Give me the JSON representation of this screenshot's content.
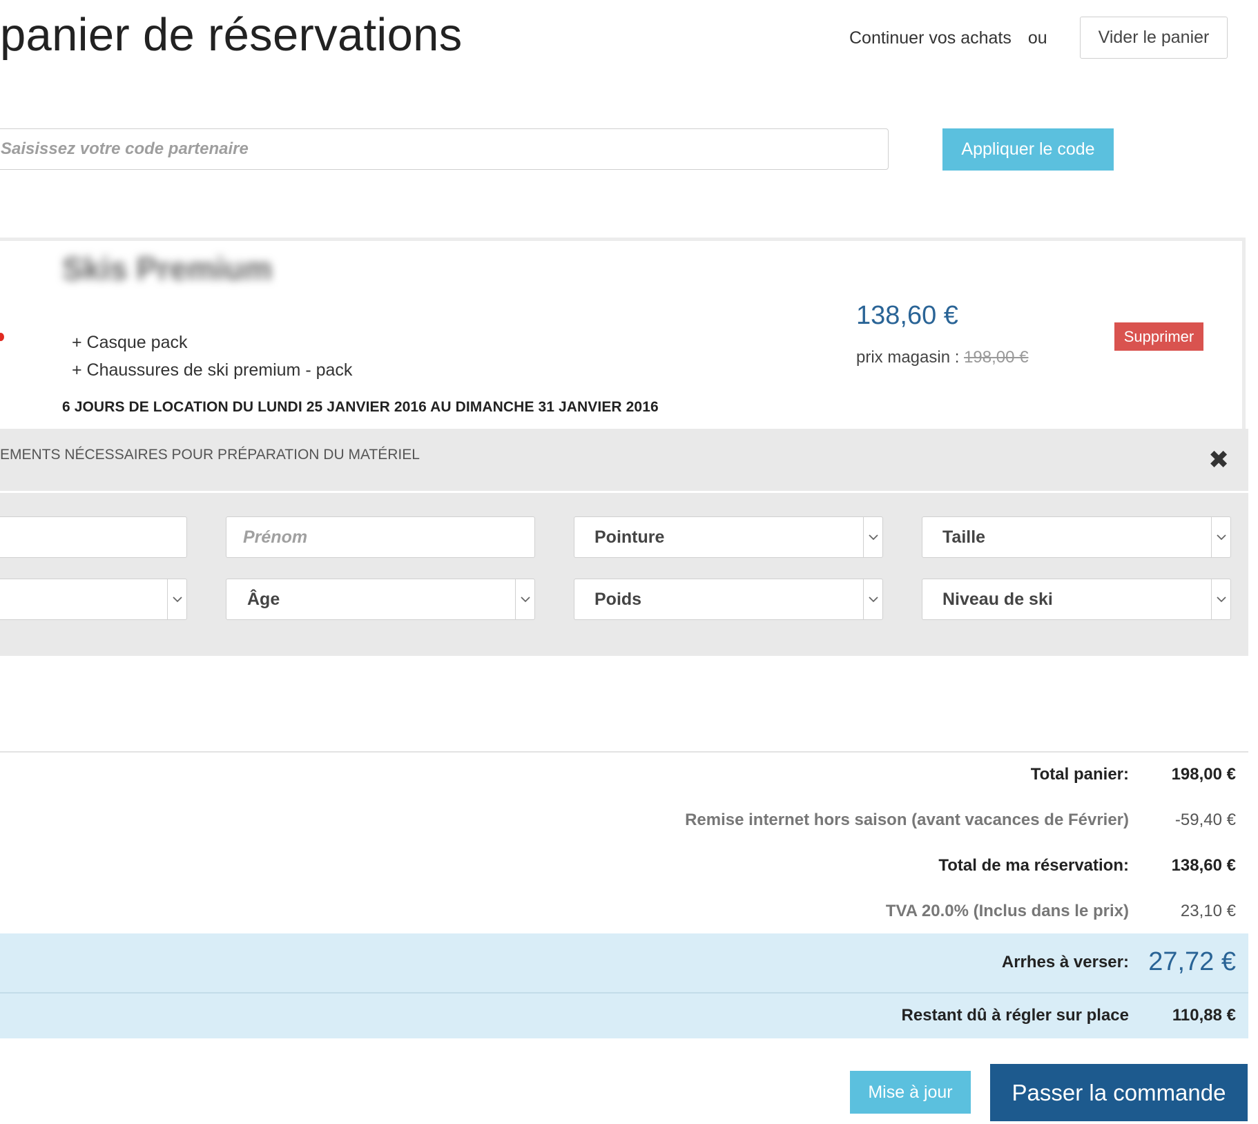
{
  "header": {
    "title": "panier de réservations",
    "continue_link": "Continuer vos achats",
    "or_text": "ou",
    "empty_cart_label": "Vider le panier"
  },
  "partner_code": {
    "placeholder": "Saisissez votre code partenaire",
    "apply_label": "Appliquer le code"
  },
  "item": {
    "name": "Skis Premium",
    "options": [
      "+ Casque pack",
      "+ Chaussures de ski premium - pack"
    ],
    "dates": "6 JOURS DE LOCATION DU LUNDI 25 JANVIER 2016 AU DIMANCHE 31 JANVIER 2016",
    "price": "138,60 €",
    "store_price_label": "prix magasin :",
    "store_price": "198,00 €",
    "delete_label": "Supprimer"
  },
  "prep_form": {
    "heading": "EMENTS NÉCESSAIRES POUR PRÉPARATION DU MATÉRIEL",
    "close_icon": "close-icon",
    "first_name_placeholder": "Prénom",
    "shoe_size_label": "Pointure",
    "height_label": "Taille",
    "age_label": "Âge",
    "weight_label": "Poids",
    "ski_level_label": "Niveau de ski"
  },
  "summary": {
    "cart_total_label": "Total panier:",
    "cart_total_value": "198,00 €",
    "discount_label": "Remise internet hors saison (avant vacances de Février)",
    "discount_value": "-59,40 €",
    "booking_total_label": "Total de ma réservation:",
    "booking_total_value": "138,60 €",
    "vat_label": "TVA 20.0% (Inclus dans le prix)",
    "vat_value": "23,10 €",
    "deposit_label": "Arrhes à verser:",
    "deposit_value": "27,72 €",
    "remaining_label": "Restant dû à régler sur place",
    "remaining_value": "110,88 €"
  },
  "actions": {
    "update_label": "Mise à jour",
    "checkout_label": "Passer la commande"
  },
  "colors": {
    "info_blue": "#5bc0de",
    "danger_red": "#d9534f",
    "primary_dark_blue": "#1d5a8e",
    "price_blue": "#2a6496",
    "band_light_blue": "#d9edf7"
  }
}
